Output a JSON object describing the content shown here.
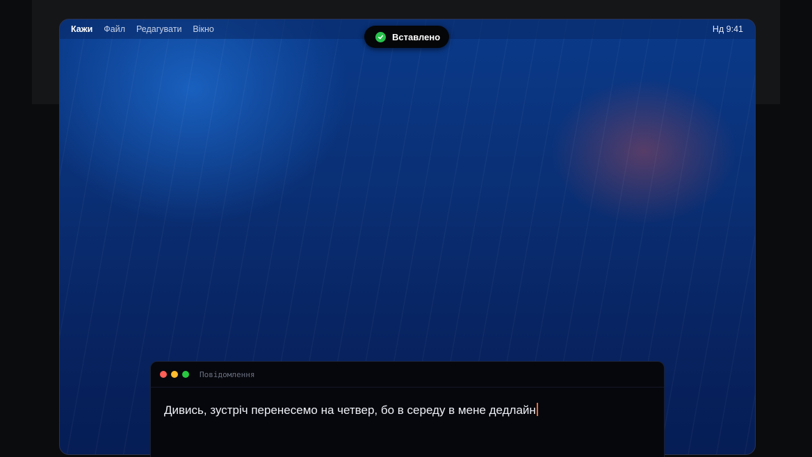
{
  "menubar": {
    "app_name": "Кажи",
    "items": [
      "Файл",
      "Редагувати",
      "Вікно"
    ],
    "clock": "Нд 9:41"
  },
  "toast": {
    "label": "Вставлено",
    "icon": "check-circle-icon",
    "accent_color": "#29c24d"
  },
  "message_window": {
    "title": "Повідомлення",
    "text": "Дивись, зустріч перенесемо на четвер, бо в середу в мене дедлайн",
    "caret_color": "#ff6a2a",
    "traffic_lights": [
      "#fe5f57",
      "#febc2e",
      "#28c840"
    ]
  }
}
